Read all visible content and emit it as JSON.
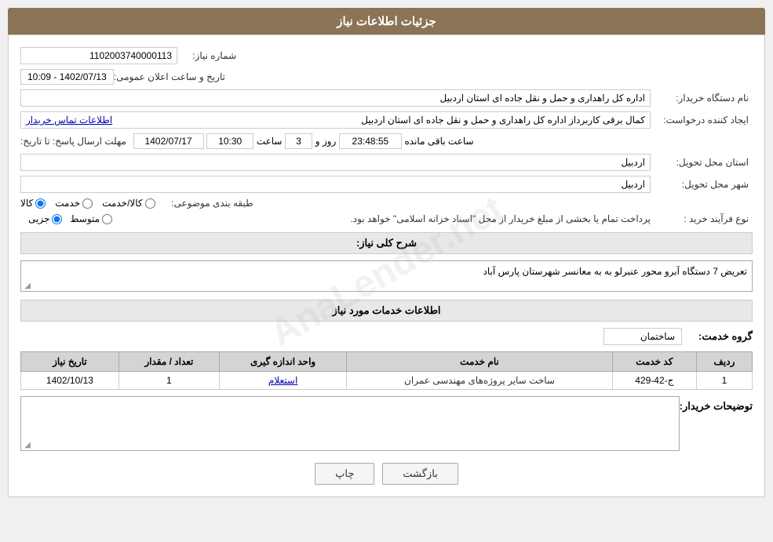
{
  "header": {
    "title": "جزئیات اطلاعات نیاز"
  },
  "fields": {
    "need_number_label": "شماره نیاز:",
    "need_number_value": "1102003740000113",
    "buyer_org_label": "نام دستگاه خریدار:",
    "buyer_org_value": "اداره کل راهداری و حمل و نقل جاده ای استان اردبیل",
    "creator_label": "ایجاد کننده درخواست:",
    "creator_value": "کمال برقی کاربرداز اداره کل راهداری و حمل و نقل جاده ای استان اردبیل",
    "contact_link": "اطلاعات تماس خریدار",
    "deadline_label": "مهلت ارسال پاسخ: تا تاریخ:",
    "announce_label": "تاریخ و ساعت اعلان عمومی:",
    "announce_date": "1402/07/13 - 10:09",
    "deadline_date": "1402/07/17",
    "deadline_time": "10:30",
    "deadline_days": "3",
    "deadline_clock": "23:48:55",
    "remaining_label": "ساعت باقی مانده",
    "days_label": "روز و",
    "time_label": "ساعت",
    "province_label": "استان محل تحویل:",
    "province_value": "اردبیل",
    "city_label": "شهر محل تحویل:",
    "city_value": "اردبیل",
    "subject_label": "طبقه بندی موضوعی:",
    "subject_kala": "کالا",
    "subject_khadamat": "خدمت",
    "subject_kala_khadamat": "کالا/خدمت",
    "process_label": "نوع فرآیند خرید :",
    "process_jozyi": "جزیی",
    "process_mootasat": "متوسط",
    "process_text": "پرداخت تمام یا بخشی از مبلغ خریدار از محل \"اسناد خزانه اسلامی\" خواهد بود.",
    "need_desc_label": "شرح کلی نیاز:",
    "need_desc_value": "تعریض 7 دستگاه آبرو محور عنبرلو به به معانسر شهرستان پارس آباد",
    "services_section_label": "اطلاعات خدمات مورد نیاز",
    "group_label": "گروه خدمت:",
    "group_value": "ساختمان",
    "table": {
      "headers": [
        "ردیف",
        "کد خدمت",
        "نام خدمت",
        "واحد اندازه گیری",
        "تعداد / مقدار",
        "تاریخ نیاز"
      ],
      "rows": [
        {
          "row": "1",
          "code": "ج-42-429",
          "name": "ساخت سایر پروژه‌های مهندسی عمران",
          "unit": "استعلام",
          "quantity": "1",
          "date": "1402/10/13"
        }
      ]
    },
    "description_label": "توضیحات خریدار:",
    "description_value": "",
    "btn_print": "چاپ",
    "btn_back": "بازگشت"
  }
}
